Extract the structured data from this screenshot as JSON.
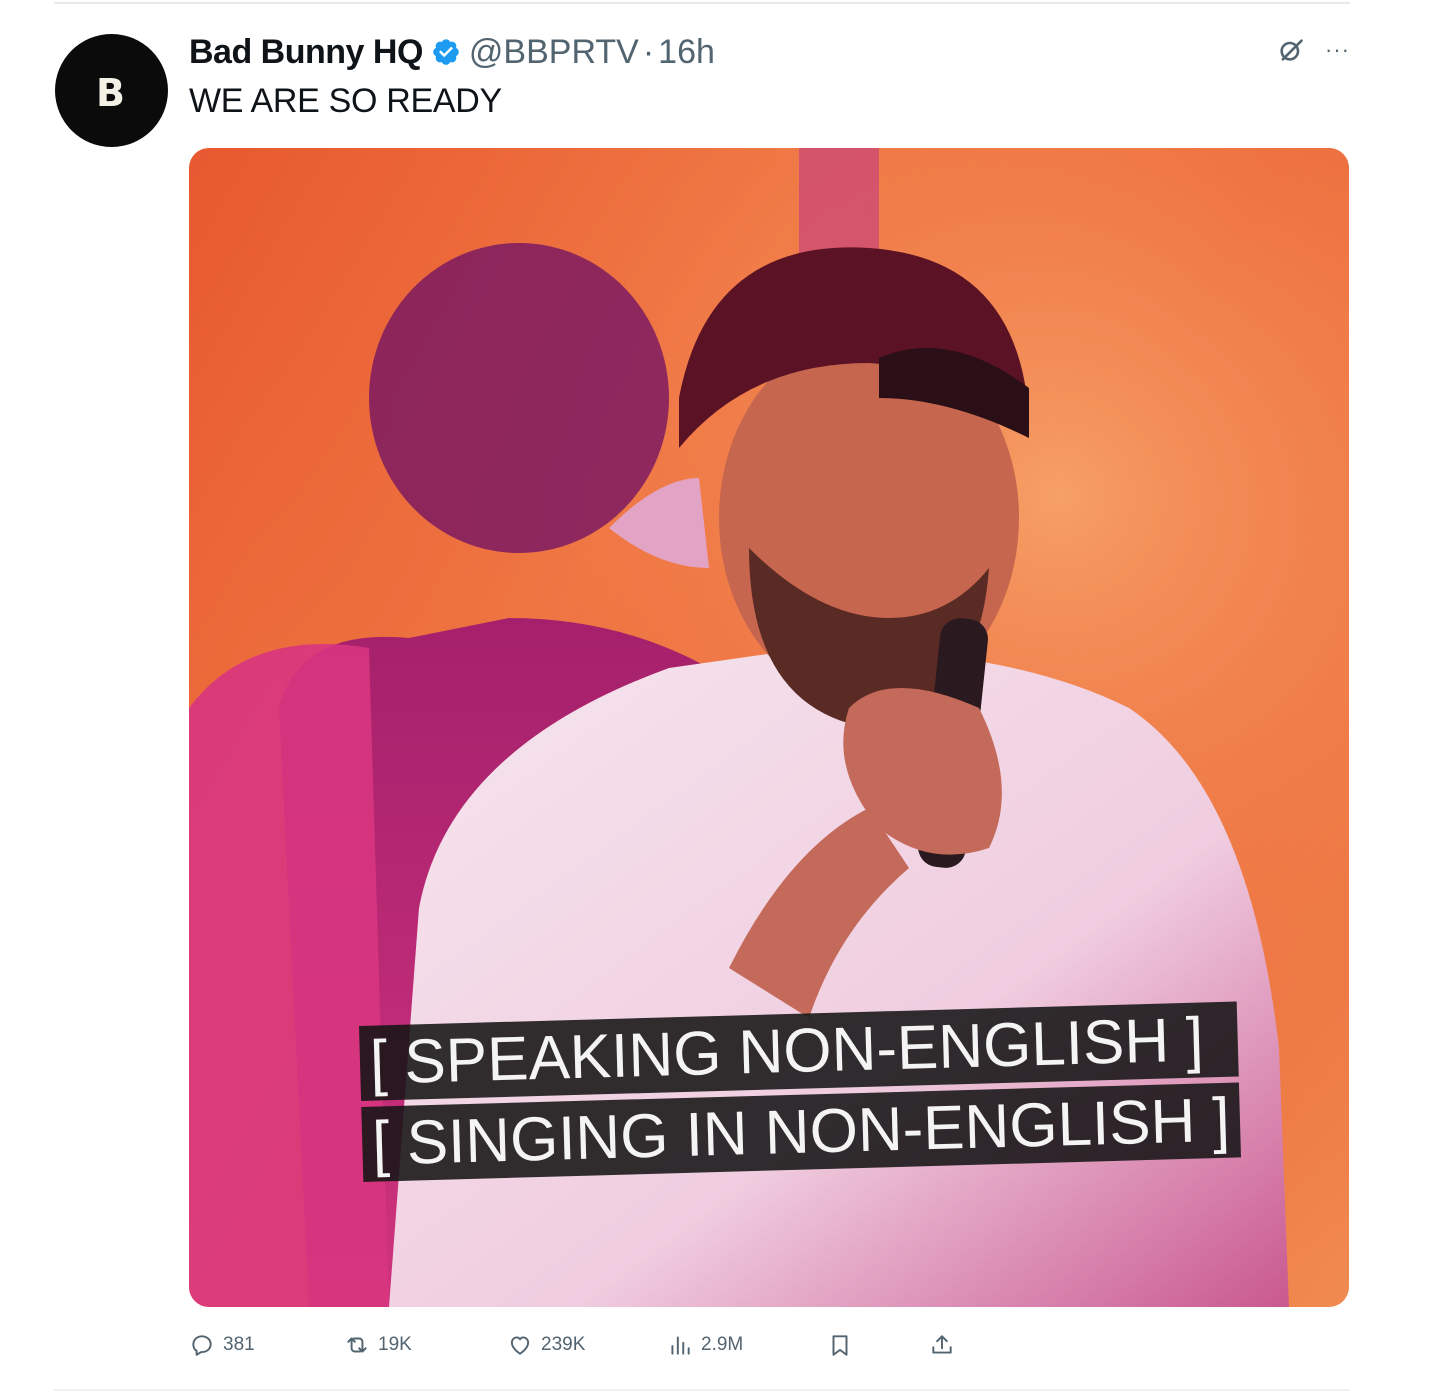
{
  "tweet": {
    "display_name": "Bad Bunny HQ",
    "verified_icon": "verified-badge-icon",
    "handle": "@BBPRTV",
    "separator": "·",
    "time": "16h",
    "text": "WE ARE SO READY",
    "avatar_logo": "B",
    "more_label": "···"
  },
  "media": {
    "captions": [
      "[ SPEAKING NON-ENGLISH ]",
      "[ SINGING IN NON-ENGLISH ]"
    ]
  },
  "actions": {
    "replies": "381",
    "reposts": "19K",
    "likes": "239K",
    "views": "2.9M"
  },
  "colors": {
    "verified": "#1d9bf0",
    "muted": "#536471",
    "text": "#0f1419"
  }
}
